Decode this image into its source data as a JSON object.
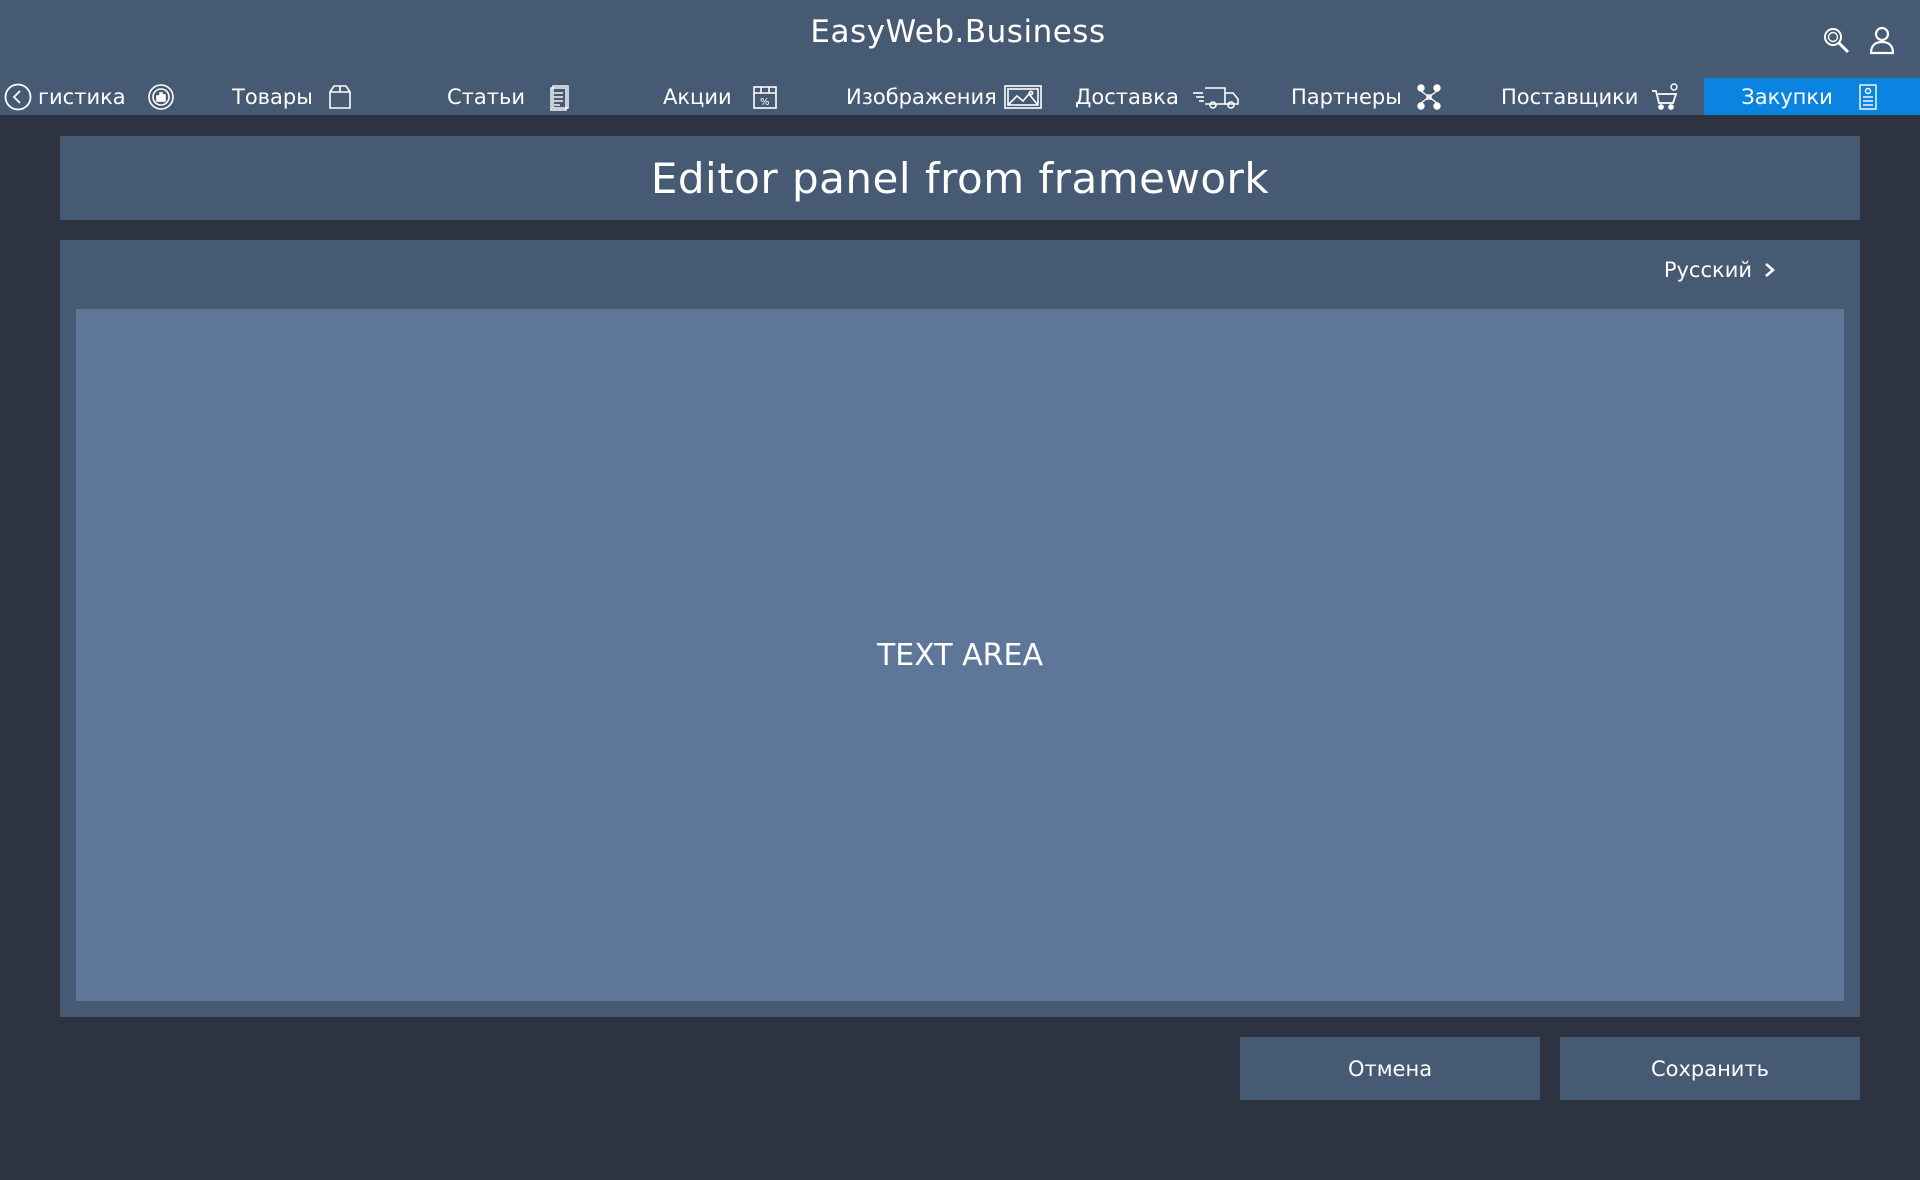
{
  "header": {
    "brand": "EasyWeb.Business",
    "icons": [
      "search-icon",
      "user-icon"
    ]
  },
  "nav": {
    "items": [
      {
        "label": "гистика",
        "icon": "analytics-icon"
      },
      {
        "label": "Товары",
        "icon": "box-icon"
      },
      {
        "label": "Статьи",
        "icon": "document-icon"
      },
      {
        "label": "Акции",
        "icon": "discount-icon"
      },
      {
        "label": "Изображения",
        "icon": "image-icon"
      },
      {
        "label": "Доставка",
        "icon": "truck-icon"
      },
      {
        "label": "Партнеры",
        "icon": "partners-icon"
      },
      {
        "label": "Поставщики",
        "icon": "cart-icon"
      },
      {
        "label": "Закупки",
        "icon": "purchase-doc-icon",
        "active": true
      }
    ],
    "active_color": "#0a84e0"
  },
  "page": {
    "title": "Editor panel from framework"
  },
  "editor": {
    "language": "Русский",
    "text_area_label": "TEXT AREA"
  },
  "actions": {
    "cancel_label": "Отмена",
    "save_label": "Сохранить"
  },
  "colors": {
    "background": "#2d3340",
    "panel": "#465a73",
    "text_area": "#5e7799",
    "accent": "#0a84e0"
  }
}
